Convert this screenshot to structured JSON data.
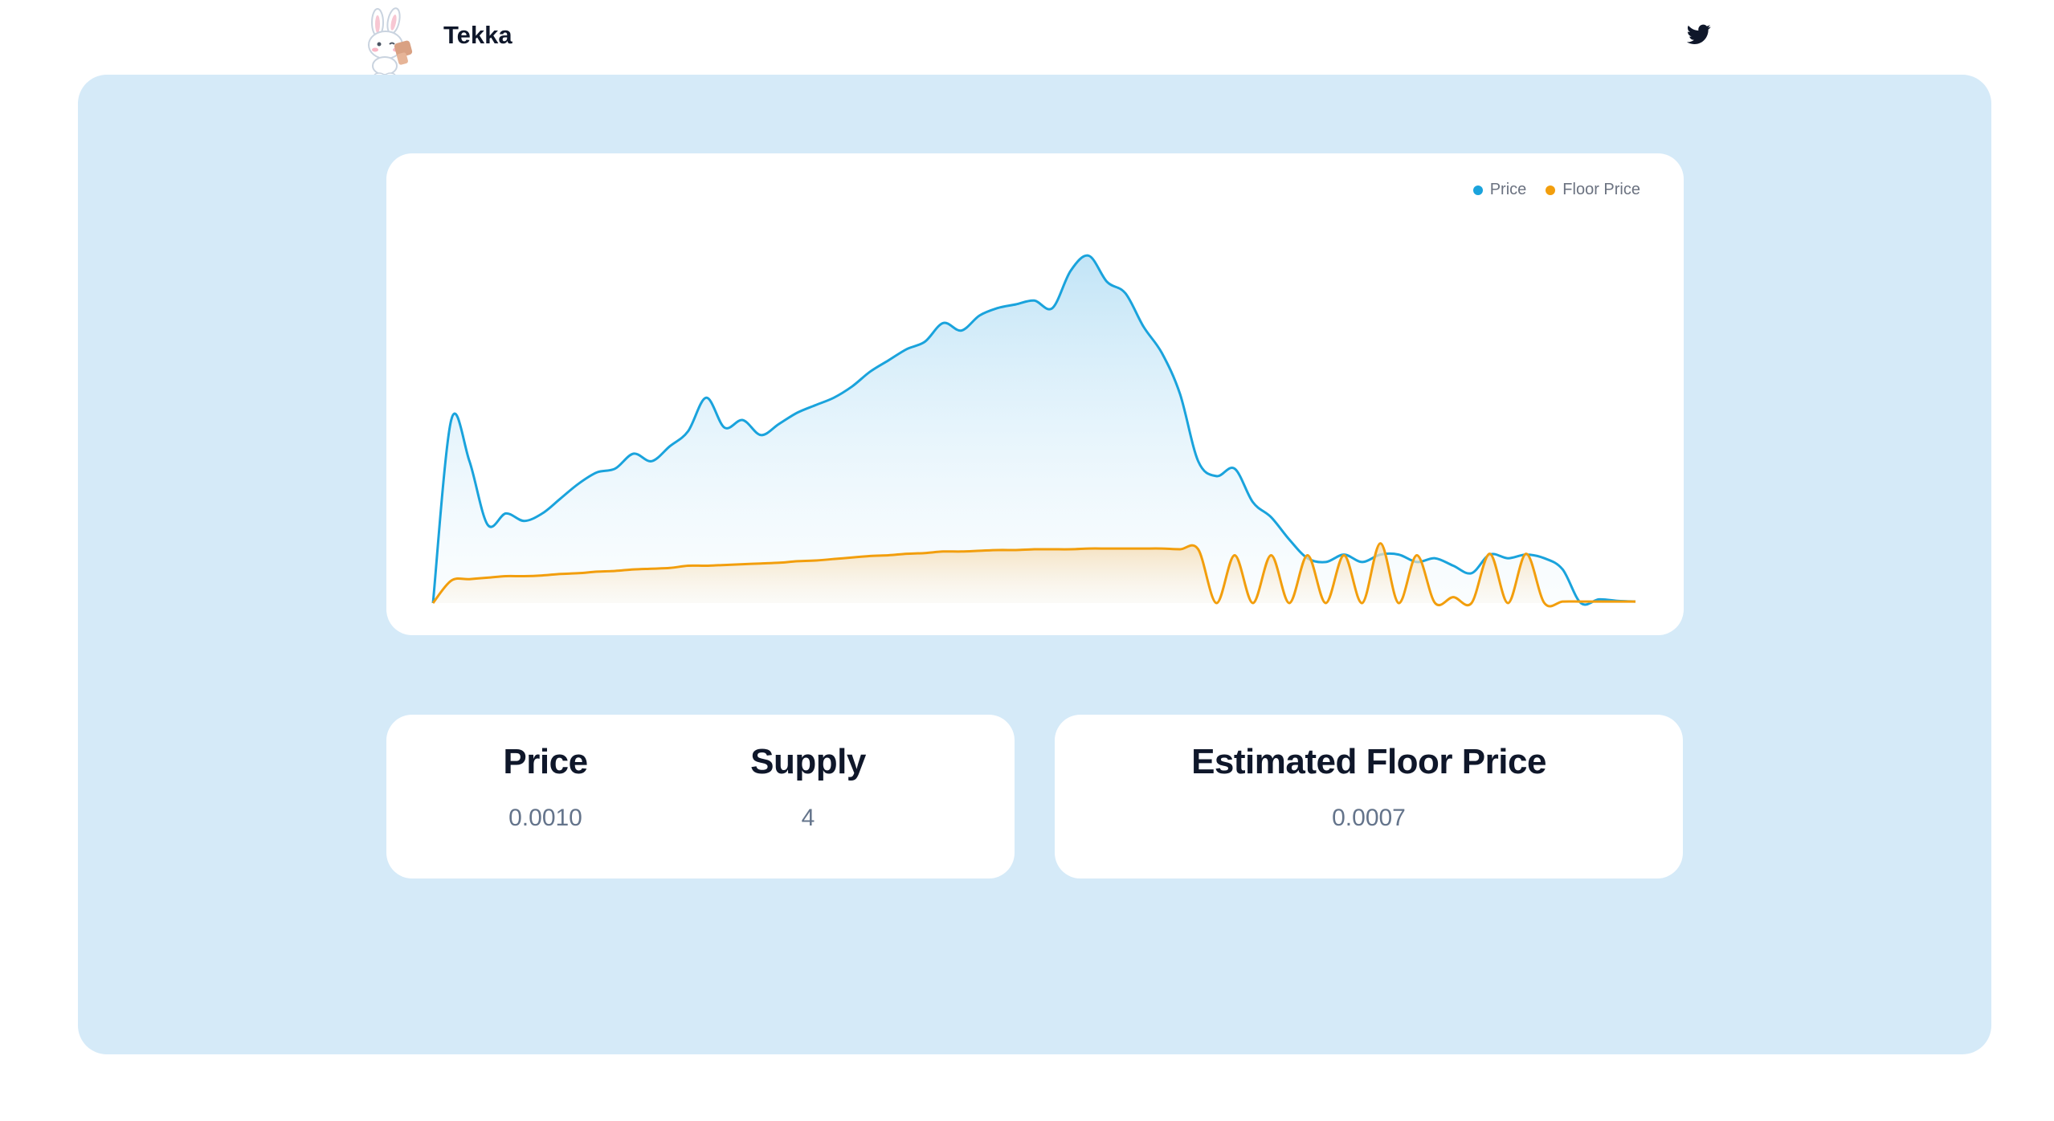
{
  "header": {
    "brand": "Tekka",
    "logo_icon": "bunny-mascot-logo",
    "social_icon": "twitter-icon"
  },
  "colors": {
    "panel_bg": "#d5eaf8",
    "price_line": "#1aa3dc",
    "floor_line": "#f29e0d",
    "heading": "#0f172a",
    "value": "#64748b"
  },
  "chart_data": {
    "type": "area",
    "title": "",
    "xlabel": "",
    "ylabel": "",
    "grid": false,
    "legend_position": "top-right",
    "series": [
      {
        "name": "Price",
        "color": "#1aa3dc",
        "values": [
          0.0,
          0.245,
          0.19,
          0.105,
          0.12,
          0.11,
          0.12,
          0.14,
          0.16,
          0.175,
          0.18,
          0.2,
          0.19,
          0.21,
          0.23,
          0.275,
          0.235,
          0.245,
          0.225,
          0.24,
          0.255,
          0.265,
          0.275,
          0.29,
          0.31,
          0.325,
          0.34,
          0.35,
          0.375,
          0.365,
          0.385,
          0.395,
          0.4,
          0.405,
          0.395,
          0.445,
          0.465,
          0.43,
          0.415,
          0.37,
          0.335,
          0.28,
          0.19,
          0.17,
          0.18,
          0.135,
          0.115,
          0.085,
          0.06,
          0.055,
          0.065,
          0.055,
          0.065,
          0.065,
          0.055,
          0.06,
          0.05,
          0.04,
          0.065,
          0.06,
          0.065,
          0.06,
          0.045,
          0.0,
          0.005,
          0.003,
          0.002
        ]
      },
      {
        "name": "Floor Price",
        "color": "#f29e0d",
        "values": [
          0.0,
          0.03,
          0.032,
          0.034,
          0.036,
          0.036,
          0.037,
          0.039,
          0.04,
          0.042,
          0.043,
          0.045,
          0.046,
          0.047,
          0.05,
          0.05,
          0.051,
          0.052,
          0.053,
          0.054,
          0.056,
          0.057,
          0.059,
          0.061,
          0.063,
          0.064,
          0.066,
          0.067,
          0.069,
          0.069,
          0.07,
          0.071,
          0.071,
          0.072,
          0.072,
          0.072,
          0.073,
          0.073,
          0.073,
          0.073,
          0.073,
          0.072,
          0.072,
          0.0,
          0.064,
          0.0,
          0.064,
          0.0,
          0.064,
          0.0,
          0.064,
          0.0,
          0.08,
          0.0,
          0.064,
          0.0,
          0.008,
          0.0,
          0.066,
          0.0,
          0.066,
          0.0,
          0.002,
          0.002,
          0.002,
          0.002,
          0.002
        ]
      }
    ]
  },
  "stats": {
    "price_label": "Price",
    "price_value": "0.0010",
    "supply_label": "Supply",
    "supply_value": "4",
    "floor_label": "Estimated Floor Price",
    "floor_value": "0.0007"
  }
}
